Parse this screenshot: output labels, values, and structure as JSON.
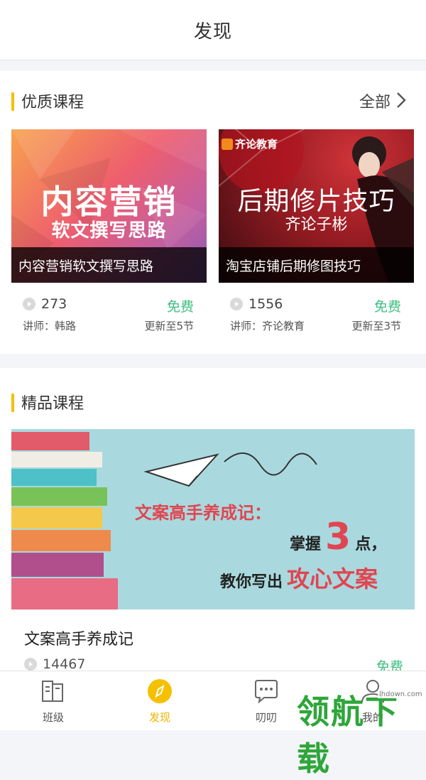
{
  "header": {
    "title": "发现"
  },
  "quality": {
    "title": "优质课程",
    "more": "全部",
    "courses": [
      {
        "banner_title": "内容营销",
        "banner_sub": "软文撰写思路",
        "caption": "内容营销软文撰写思路",
        "views": "273",
        "price": "免费",
        "teacher": "讲师：韩路",
        "update": "更新至5节"
      },
      {
        "banner_logo": "齐论教育",
        "banner_title": "后期修片技巧",
        "banner_sub": "齐论子彬",
        "caption": "淘宝店铺后期修图技巧",
        "views": "1556",
        "price": "免费",
        "teacher": "讲师：齐论教育",
        "update": "更新至3节"
      }
    ]
  },
  "premium": {
    "title": "精品课程",
    "banner": {
      "line1": "文案高手养成记：",
      "line2a": "掌握",
      "line2b": "3",
      "line2c": "点，",
      "line3a": "教你写出",
      "line3b": "攻心文案"
    },
    "course_title": "文案高手养成记",
    "views": "14467",
    "price": "免费"
  },
  "tabs": [
    {
      "label": "班级",
      "icon": "class-icon"
    },
    {
      "label": "发现",
      "icon": "discover-compass-icon",
      "active": true
    },
    {
      "label": "叨叨",
      "icon": "chat-icon"
    },
    {
      "label": "我的",
      "icon": "profile-icon"
    }
  ],
  "watermark": {
    "text": "领航下载",
    "url": "lhdown.com"
  },
  "colors": {
    "accent": "#f5c000",
    "free": "#3dbf83",
    "active_tab": "#f0b400"
  }
}
